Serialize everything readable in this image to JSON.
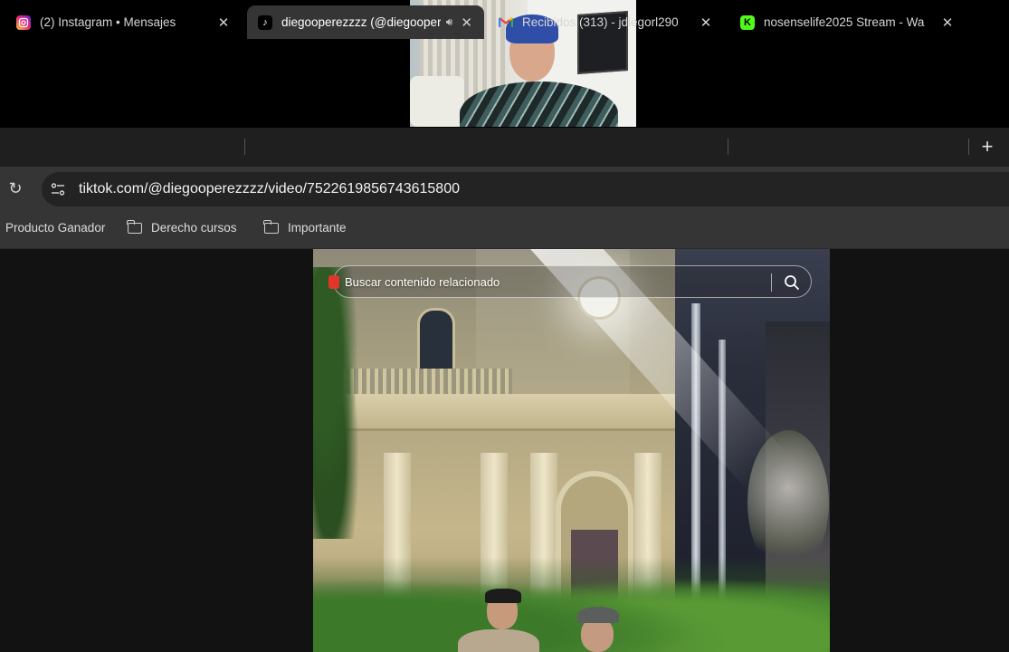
{
  "tabs": [
    {
      "title": "(2) Instagram • Mensajes",
      "favicon": "instagram-icon",
      "color": "#d62976"
    },
    {
      "title": "diegooperezzzz (@diegooperezzzz)",
      "favicon": "tiktok-icon",
      "color": "#000000",
      "active": true
    },
    {
      "title": "Recibidos (313) - jdiegorl290",
      "favicon": "gmail-icon",
      "color": "#ea4335"
    },
    {
      "title": "nosenselife2025 Stream - Wa",
      "favicon": "kick-icon",
      "color": "#53fc18"
    }
  ],
  "address": {
    "url": "tiktok.com/@diegooperezzzz/video/7522619856743615800"
  },
  "bookmarks": [
    {
      "label": "Producto Ganador"
    },
    {
      "label": "Derecho cursos"
    },
    {
      "label": "Importante"
    }
  ],
  "video": {
    "search_placeholder": "Buscar contenido relacionado"
  },
  "colors": {
    "tab_strip": "#1f1f1f",
    "toolbar": "#353535",
    "omnibox": "#232323",
    "page_bg": "#121212"
  }
}
